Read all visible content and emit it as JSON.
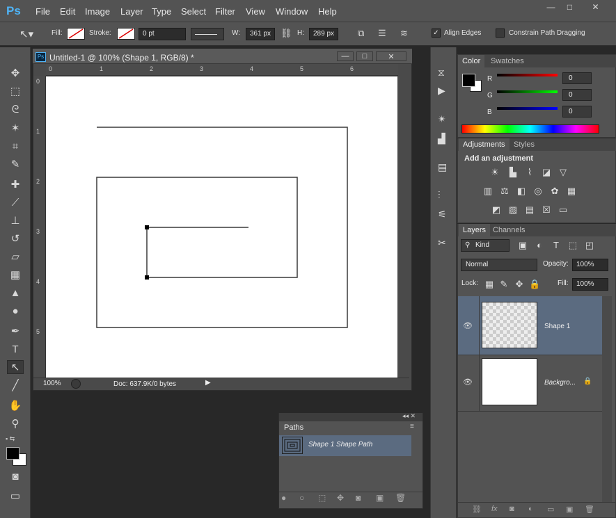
{
  "app": {
    "logo": "Ps"
  },
  "menu": [
    "File",
    "Edit",
    "Image",
    "Layer",
    "Type",
    "Select",
    "Filter",
    "View",
    "Window",
    "Help"
  ],
  "window_controls": {
    "minimize": "—",
    "maximize": "□",
    "close": "✕"
  },
  "options": {
    "fill_label": "Fill:",
    "stroke_label": "Stroke:",
    "stroke_width": "0 pt",
    "w_label": "W:",
    "w_value": "361 px",
    "h_label": "H:",
    "h_value": "289 px",
    "align_edges": "Align Edges",
    "align_edges_checked": true,
    "constrain": "Constrain Path Dragging",
    "constrain_checked": false
  },
  "document": {
    "title": "Untitled-1 @ 100% (Shape 1, RGB/8) *",
    "ruler_h": [
      "0",
      "1",
      "2",
      "3",
      "4",
      "5",
      "6"
    ],
    "ruler_v": [
      "0",
      "1",
      "2",
      "3",
      "4",
      "5"
    ],
    "zoom": "100%",
    "doc_info": "Doc: 637.9K/0 bytes"
  },
  "color_panel": {
    "tabs": [
      "Color",
      "Swatches"
    ],
    "channels": [
      {
        "label": "R",
        "value": "0"
      },
      {
        "label": "G",
        "value": "0"
      },
      {
        "label": "B",
        "value": "0"
      }
    ]
  },
  "adjustments_panel": {
    "tabs": [
      "Adjustments",
      "Styles"
    ],
    "heading": "Add an adjustment"
  },
  "layers_panel": {
    "tabs": [
      "Layers",
      "Channels"
    ],
    "filter": "Kind",
    "blend_mode": "Normal",
    "opacity_label": "Opacity:",
    "opacity": "100%",
    "lock_label": "Lock:",
    "fill_label": "Fill:",
    "fill": "100%",
    "layers": [
      {
        "name": "Shape 1",
        "selected": true
      },
      {
        "name": "Backgro...",
        "selected": false
      }
    ]
  },
  "paths_panel": {
    "tab": "Paths",
    "items": [
      {
        "name": "Shape 1 Shape Path"
      }
    ]
  },
  "colors": {
    "accent": "#4fb3f5",
    "selected_row": "#5b6b80"
  }
}
